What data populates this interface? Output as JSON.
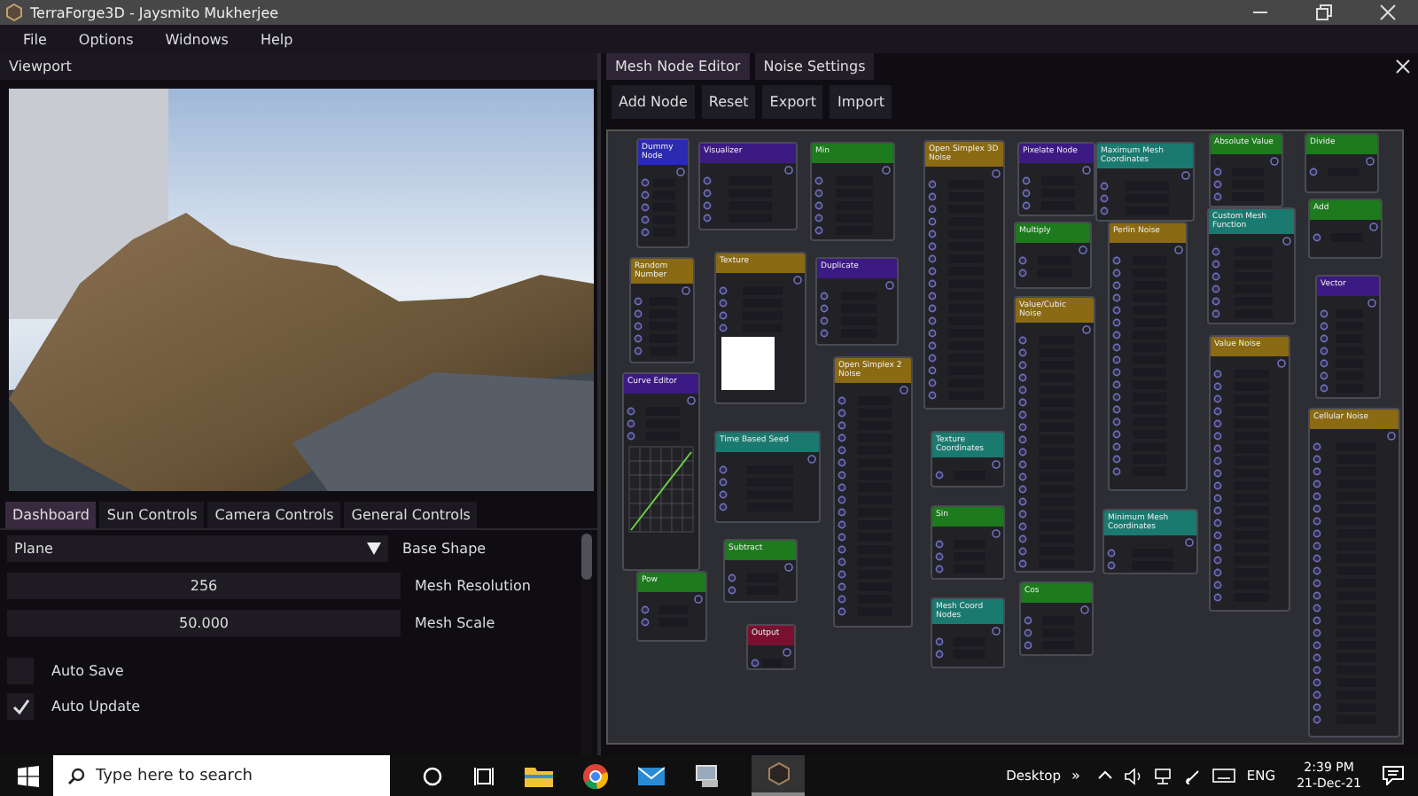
{
  "window": {
    "title": "TerraForge3D - Jaysmito Mukherjee"
  },
  "menu": [
    "File",
    "Options",
    "Widnows",
    "Help"
  ],
  "viewport": {
    "title": "Viewport"
  },
  "dashboard": {
    "tabs": [
      {
        "label": "Dashboard",
        "selected": true
      },
      {
        "label": "Sun Controls",
        "selected": false
      },
      {
        "label": "Camera Controls",
        "selected": false
      },
      {
        "label": "General Controls",
        "selected": false
      }
    ],
    "base_shape": {
      "value": "Plane",
      "label": "Base Shape"
    },
    "fields": [
      {
        "value": "256",
        "label": "Mesh Resolution"
      },
      {
        "value": "50.000",
        "label": "Mesh Scale"
      }
    ],
    "checkboxes": [
      {
        "label": "Auto Save",
        "checked": false
      },
      {
        "label": "Auto Update",
        "checked": true
      }
    ]
  },
  "node_editor": {
    "tabs": [
      {
        "label": "Mesh Node Editor",
        "selected": true
      },
      {
        "label": "Noise Settings",
        "selected": false
      }
    ],
    "toolbar": [
      "Add Node",
      "Reset",
      "Export",
      "Import"
    ],
    "nodes": [
      {
        "title": "Dummy Node",
        "color": "#2b2bb0",
        "kind": "plain"
      },
      {
        "title": "Random Number",
        "color": "#8a6a12",
        "kind": "plain"
      },
      {
        "title": "Curve Editor",
        "color": "#3c1a84",
        "kind": "curve"
      },
      {
        "title": "Pow",
        "color": "#1d7a1d",
        "kind": "plain"
      },
      {
        "title": "Visualizer",
        "color": "#3c1a84",
        "kind": "plain"
      },
      {
        "title": "Texture",
        "color": "#8a6a12",
        "kind": "texture"
      },
      {
        "title": "Time Based Seed",
        "color": "#1a7a70",
        "kind": "plain"
      },
      {
        "title": "Subtract",
        "color": "#1d7a1d",
        "kind": "plain"
      },
      {
        "title": "Output",
        "color": "#7a1030",
        "kind": "plain"
      },
      {
        "title": "Min",
        "color": "#1d7a1d",
        "kind": "plain"
      },
      {
        "title": "Duplicate",
        "color": "#3c1a84",
        "kind": "plain"
      },
      {
        "title": "Open Simplex 2 Noise",
        "color": "#8a6a12",
        "kind": "plain"
      },
      {
        "title": "Open Simplex 3D Noise",
        "color": "#8a6a12",
        "kind": "plain"
      },
      {
        "title": "Texture Coordinates",
        "color": "#1a7a70",
        "kind": "plain"
      },
      {
        "title": "Sin",
        "color": "#1d7a1d",
        "kind": "plain"
      },
      {
        "title": "Mesh Coord Nodes",
        "color": "#1a7a70",
        "kind": "plain"
      },
      {
        "title": "Pixelate Node",
        "color": "#3c1a84",
        "kind": "plain"
      },
      {
        "title": "Multiply",
        "color": "#1d7a1d",
        "kind": "plain"
      },
      {
        "title": "Value/Cubic Noise",
        "color": "#8a6a12",
        "kind": "plain"
      },
      {
        "title": "Cos",
        "color": "#1d7a1d",
        "kind": "plain"
      },
      {
        "title": "Maximum Mesh Coordinates",
        "color": "#1a7a70",
        "kind": "plain"
      },
      {
        "title": "Perlin Noise",
        "color": "#8a6a12",
        "kind": "plain"
      },
      {
        "title": "Minimum Mesh Coordinates",
        "color": "#1a7a70",
        "kind": "plain"
      },
      {
        "title": "Absolute Value",
        "color": "#1d7a1d",
        "kind": "plain"
      },
      {
        "title": "Custom Mesh Function",
        "color": "#1a7a70",
        "kind": "plain"
      },
      {
        "title": "Value Noise",
        "color": "#8a6a12",
        "kind": "plain"
      },
      {
        "title": "Divide",
        "color": "#1d7a1d",
        "kind": "plain"
      },
      {
        "title": "Add",
        "color": "#1d7a1d",
        "kind": "plain"
      },
      {
        "title": "Vector",
        "color": "#3c1a84",
        "kind": "plain"
      },
      {
        "title": "Cellular Noise",
        "color": "#8a6a12",
        "kind": "plain"
      }
    ]
  },
  "taskbar": {
    "search": {
      "placeholder": "Type here to search"
    },
    "desktop": "Desktop",
    "overflow": "»",
    "language": "ENG",
    "time": "2:39 PM",
    "date": "21-Dec-21"
  }
}
